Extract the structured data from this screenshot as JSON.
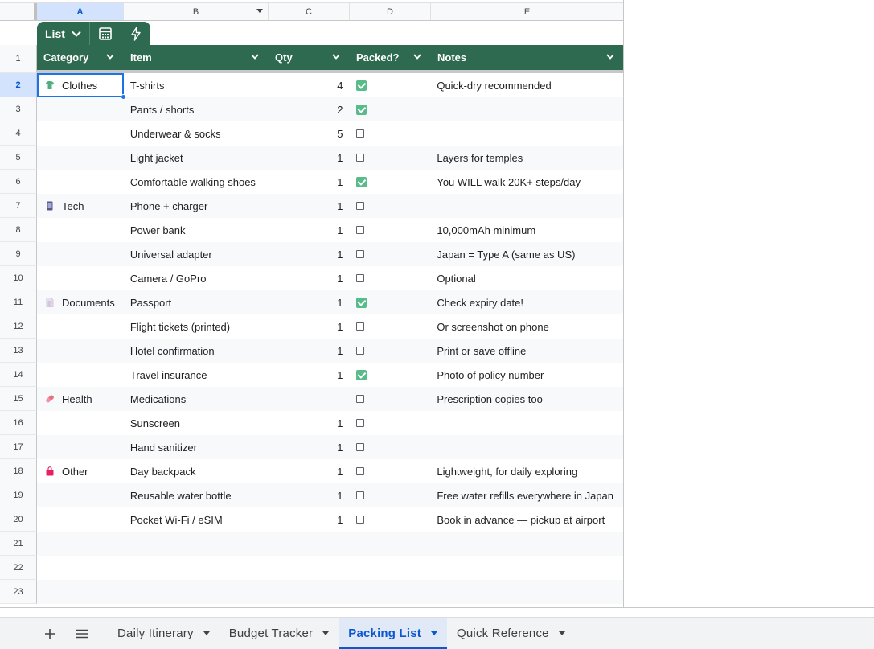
{
  "columns": [
    "A",
    "B",
    "C",
    "D",
    "E"
  ],
  "table_toolbar": {
    "view_label": "List"
  },
  "header": {
    "category": "Category",
    "item": "Item",
    "qty": "Qty",
    "packed": "Packed?",
    "notes": "Notes"
  },
  "row_numbers": [
    "1",
    "2",
    "3",
    "4",
    "5",
    "6",
    "7",
    "8",
    "9",
    "10",
    "11",
    "12",
    "13",
    "14",
    "15",
    "16",
    "17",
    "18",
    "19",
    "20",
    "21",
    "22",
    "23"
  ],
  "rows": [
    {
      "category": "Clothes",
      "icon": "tshirt-icon",
      "item": "T-shirts",
      "qty": "4",
      "packed": true,
      "notes": "Quick-dry recommended"
    },
    {
      "category": "",
      "icon": "",
      "item": "Pants / shorts",
      "qty": "2",
      "packed": true,
      "notes": ""
    },
    {
      "category": "",
      "icon": "",
      "item": "Underwear & socks",
      "qty": "5",
      "packed": false,
      "notes": ""
    },
    {
      "category": "",
      "icon": "",
      "item": "Light jacket",
      "qty": "1",
      "packed": false,
      "notes": "Layers for temples"
    },
    {
      "category": "",
      "icon": "",
      "item": "Comfortable walking shoes",
      "qty": "1",
      "packed": true,
      "notes": "You WILL walk 20K+ steps/day"
    },
    {
      "category": "Tech",
      "icon": "phone-icon",
      "item": "Phone + charger",
      "qty": "1",
      "packed": false,
      "notes": ""
    },
    {
      "category": "",
      "icon": "",
      "item": "Power bank",
      "qty": "1",
      "packed": false,
      "notes": "10,000mAh minimum"
    },
    {
      "category": "",
      "icon": "",
      "item": "Universal adapter",
      "qty": "1",
      "packed": false,
      "notes": "Japan = Type A (same as US)"
    },
    {
      "category": "",
      "icon": "",
      "item": "Camera / GoPro",
      "qty": "1",
      "packed": false,
      "notes": "Optional"
    },
    {
      "category": "Documents",
      "icon": "document-icon",
      "item": "Passport",
      "qty": "1",
      "packed": true,
      "notes": "Check expiry date!"
    },
    {
      "category": "",
      "icon": "",
      "item": "Flight tickets (printed)",
      "qty": "1",
      "packed": false,
      "notes": "Or screenshot on phone"
    },
    {
      "category": "",
      "icon": "",
      "item": "Hotel confirmation",
      "qty": "1",
      "packed": false,
      "notes": "Print or save offline"
    },
    {
      "category": "",
      "icon": "",
      "item": "Travel insurance",
      "qty": "1",
      "packed": true,
      "notes": "Photo of policy number"
    },
    {
      "category": "Health",
      "icon": "pill-icon",
      "item": "Medications",
      "qty": "—",
      "packed": false,
      "notes": "Prescription copies too"
    },
    {
      "category": "",
      "icon": "",
      "item": "Sunscreen",
      "qty": "1",
      "packed": false,
      "notes": ""
    },
    {
      "category": "",
      "icon": "",
      "item": "Hand sanitizer",
      "qty": "1",
      "packed": false,
      "notes": ""
    },
    {
      "category": "Other",
      "icon": "shopping-bag-icon",
      "item": "Day backpack",
      "qty": "1",
      "packed": false,
      "notes": "Lightweight, for daily exploring"
    },
    {
      "category": "",
      "icon": "",
      "item": "Reusable water bottle",
      "qty": "1",
      "packed": false,
      "notes": "Free water refills everywhere in Japan"
    },
    {
      "category": "",
      "icon": "",
      "item": "Pocket Wi-Fi / eSIM",
      "qty": "1",
      "packed": false,
      "notes": "Book in advance — pickup at airport"
    }
  ],
  "sheet_tabs": [
    {
      "label": "Daily Itinerary",
      "active": false
    },
    {
      "label": "Budget Tracker",
      "active": false
    },
    {
      "label": "Packing List",
      "active": true
    },
    {
      "label": "Quick Reference",
      "active": false
    }
  ],
  "colors": {
    "header_green": "#2d6a4f",
    "checked_green": "#57bb8a",
    "selection_blue": "#1a73e8"
  }
}
